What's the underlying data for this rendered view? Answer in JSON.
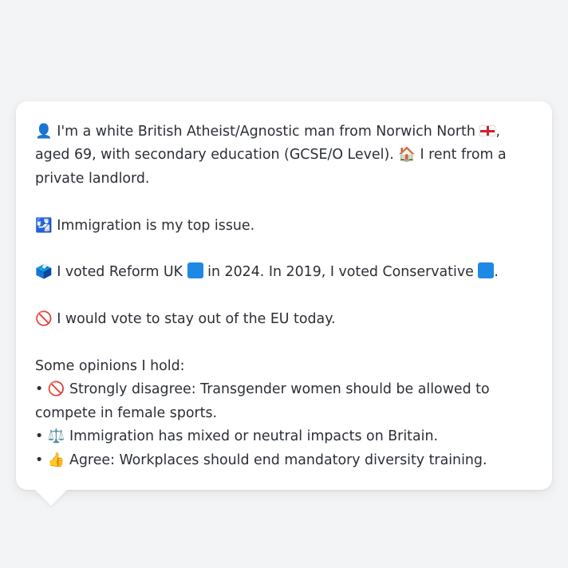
{
  "profile": {
    "intro_icon": "bust-in-silhouette",
    "intro_icon_glyph": "👤",
    "intro_text_1": "I'm a white British Atheist/Agnostic man from Norwich North",
    "england_flag_icon": "england-flag",
    "intro_text_2": ", aged 69, with secondary education (GCSE/O Level).",
    "house_icon": "house",
    "house_icon_glyph": "🏠",
    "housing_text": "I rent from a private landlord."
  },
  "top_issue": {
    "icon": "passport-control",
    "icon_glyph": "🛂",
    "text": "Immigration is my top issue."
  },
  "voting": {
    "icon": "ballot-box",
    "icon_glyph": "🗳️",
    "text_1": "I voted Reform UK",
    "reform_color": "#1e88e5",
    "text_2": "in 2024. In 2019, I voted Conservative",
    "conservative_color": "#1e88e5",
    "text_3": "."
  },
  "eu": {
    "icon": "prohibited",
    "icon_glyph": "🚫",
    "text": "I would vote to stay out of the EU today."
  },
  "opinions": {
    "heading": "Some opinions I hold:",
    "bullet": "•",
    "items": [
      {
        "icon": "prohibited",
        "glyph": "🚫",
        "text": "Strongly disagree: Transgender women should be allowed to compete in female sports."
      },
      {
        "icon": "balance-scale",
        "glyph": "⚖️",
        "text": "Immigration has mixed or neutral impacts on Britain."
      },
      {
        "icon": "thumbs-up",
        "glyph": "👍",
        "text": "Agree: Workplaces should end mandatory diversity training."
      }
    ]
  }
}
